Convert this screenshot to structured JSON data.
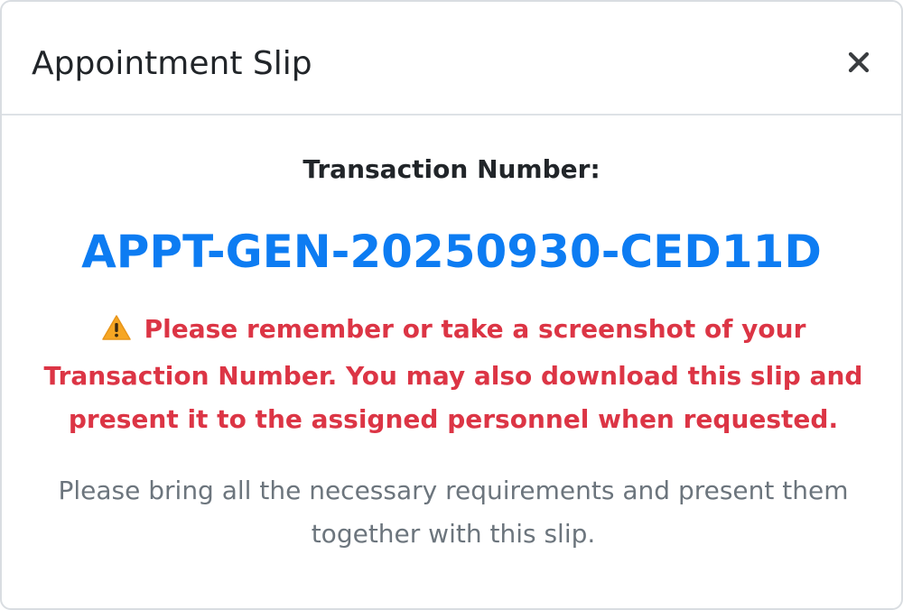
{
  "modal": {
    "title": "Appointment Slip",
    "close_icon": "close-icon"
  },
  "body": {
    "transaction_label": "Transaction Number:",
    "transaction_number": "APPT-GEN-20250930-CED11D",
    "warning_icon": "warning-icon",
    "warning_text": "Please remember or take a screenshot of your Transaction Number. You may also download this slip and present it to the assigned personnel when requested.",
    "note_text": "Please bring all the necessary requirements and present them together with this slip."
  },
  "colors": {
    "transaction_number": "#0d7cf2",
    "warning": "#dc3545",
    "muted": "#6c757d",
    "title": "#212529"
  }
}
